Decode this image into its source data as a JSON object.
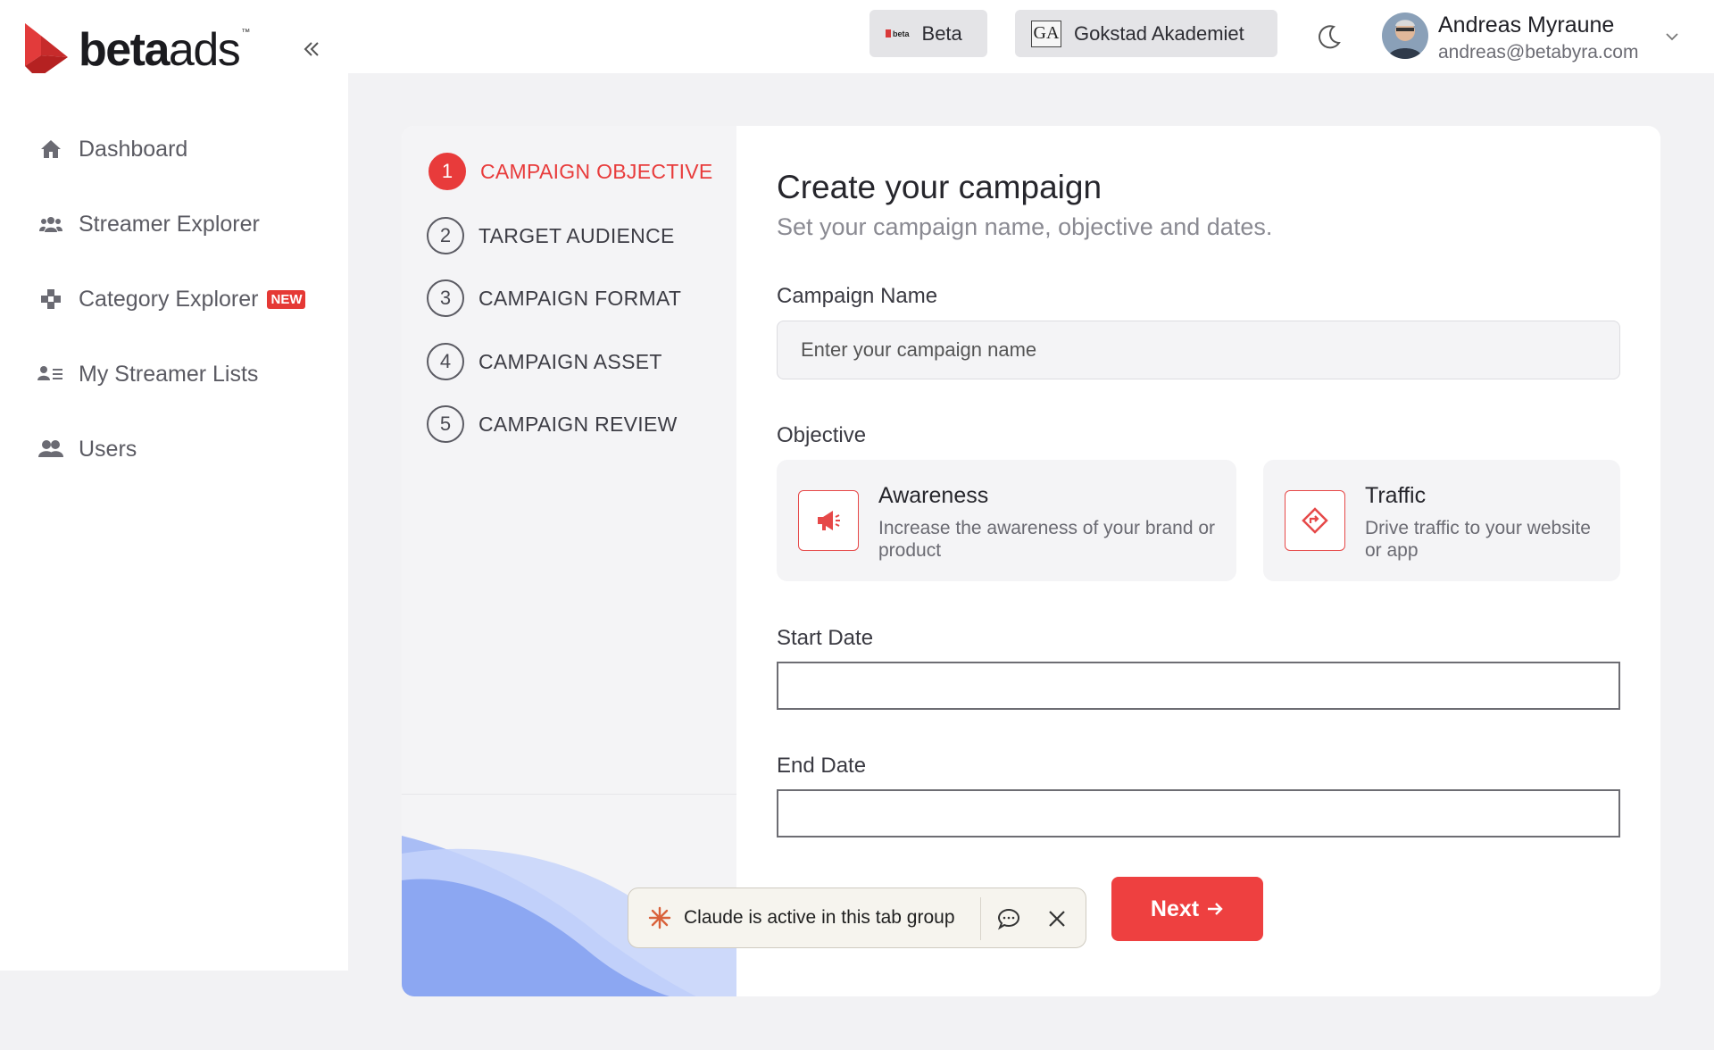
{
  "brand": {
    "name_bold": "beta",
    "name_thin": "ads",
    "tm": "™"
  },
  "header": {
    "workspace_beta": "Beta",
    "workspace_beta_logo": "beta",
    "workspace_org": "Gokstad Akademiet",
    "workspace_org_logo": "GA",
    "user": {
      "name": "Andreas Myraune",
      "email": "andreas@betabyra.com"
    }
  },
  "sidebar": {
    "items": [
      {
        "label": "Dashboard",
        "icon": "home-icon"
      },
      {
        "label": "Streamer Explorer",
        "icon": "users-group-icon"
      },
      {
        "label": "Category Explorer",
        "icon": "gamepad-icon",
        "badge": "NEW"
      },
      {
        "label": "My Streamer Lists",
        "icon": "user-list-icon"
      },
      {
        "label": "Users",
        "icon": "users-icon"
      }
    ]
  },
  "steps": [
    {
      "num": "1",
      "label": "CAMPAIGN OBJECTIVE",
      "active": true
    },
    {
      "num": "2",
      "label": "TARGET AUDIENCE"
    },
    {
      "num": "3",
      "label": "CAMPAIGN FORMAT"
    },
    {
      "num": "4",
      "label": "CAMPAIGN ASSET"
    },
    {
      "num": "5",
      "label": "CAMPAIGN REVIEW"
    }
  ],
  "form": {
    "title": "Create your campaign",
    "subtitle": "Set your campaign name, objective and dates.",
    "name_label": "Campaign Name",
    "name_placeholder": "Enter your campaign name",
    "name_value": "",
    "objective_label": "Objective",
    "objectives": [
      {
        "title": "Awareness",
        "desc": "Increase the awareness of your brand or product",
        "icon": "megaphone-icon"
      },
      {
        "title": "Traffic",
        "desc": "Drive traffic to your website or app",
        "icon": "direction-sign-icon"
      }
    ],
    "start_label": "Start Date",
    "start_value": "",
    "end_label": "End Date",
    "end_value": "",
    "next_label": "Next"
  },
  "toast": {
    "text": "Claude is active in this tab group"
  },
  "colors": {
    "accent": "#EE4040",
    "active_step": "#E83B3B",
    "sidebar_bg": "#FFFFFF",
    "page_bg": "#F2F2F4"
  }
}
